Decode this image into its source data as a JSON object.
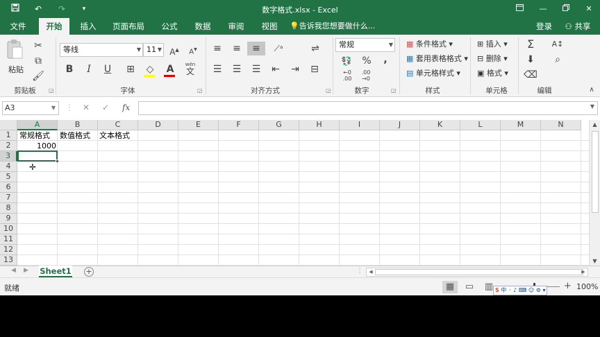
{
  "titlebar": {
    "title": "数字格式.xlsx - Excel",
    "save_icon": "save-icon",
    "undo_icon": "undo-icon",
    "redo_icon": "redo-icon",
    "customize_icon": "customize-qat-icon"
  },
  "tabs": {
    "items": [
      "文件",
      "开始",
      "插入",
      "页面布局",
      "公式",
      "数据",
      "审阅",
      "视图"
    ],
    "active": "开始",
    "tell_me": "告诉我您想要做什么...",
    "login": "登录",
    "share": "共享"
  },
  "ribbon": {
    "clipboard": {
      "label": "剪贴板",
      "paste": "粘贴"
    },
    "font": {
      "label": "字体",
      "name": "等线",
      "size": "11",
      "bold": "B",
      "italic": "I",
      "underline": "U",
      "font_color": "A",
      "wen": "wén",
      "wen_char": "文"
    },
    "align": {
      "label": "对齐方式"
    },
    "number": {
      "label": "数字",
      "format": "常规",
      "percent": "%",
      "comma": ","
    },
    "styles": {
      "label": "样式",
      "conditional": "条件格式",
      "table": "套用表格格式",
      "cell_styles": "单元格样式"
    },
    "cells": {
      "label": "单元格",
      "insert": "插入",
      "delete": "删除",
      "format": "格式"
    },
    "editing": {
      "label": "编辑"
    }
  },
  "formula_bar": {
    "name_box": "A3",
    "cancel": "✕",
    "enter": "✓",
    "fx": "fx",
    "value": ""
  },
  "sheet": {
    "columns": [
      "A",
      "B",
      "C",
      "D",
      "E",
      "F",
      "G",
      "H",
      "I",
      "J",
      "K",
      "L",
      "M",
      "N"
    ],
    "rows": [
      "1",
      "2",
      "3",
      "4",
      "5",
      "6",
      "7",
      "8",
      "9",
      "10",
      "11",
      "12",
      "13"
    ],
    "selected_col": "A",
    "selected_row": "3",
    "cells": {
      "A1": "常规格式",
      "B1": "数值格式",
      "C1": "文本格式",
      "A2": "1000"
    }
  },
  "sheet_tabs": {
    "active": "Sheet1"
  },
  "status": {
    "text": "就绪",
    "zoom": "100%",
    "zoom_plus": "+"
  },
  "colors": {
    "accent": "#217346",
    "font_color_bar": "#e00000",
    "highlight_bar": "#ffff00"
  }
}
